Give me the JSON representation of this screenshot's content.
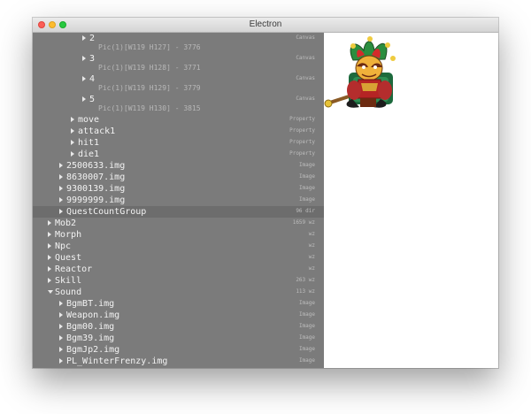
{
  "window": {
    "title": "Electron"
  },
  "tree": [
    {
      "label": "2",
      "type": "Canvas",
      "depth": 4,
      "arrow": "right",
      "sub": "Pic(1)[W119 H127] - 3776"
    },
    {
      "label": "3",
      "type": "Canvas",
      "depth": 4,
      "arrow": "right",
      "sub": "Pic(1)[W119 H128] - 3771"
    },
    {
      "label": "4",
      "type": "Canvas",
      "depth": 4,
      "arrow": "right",
      "sub": "Pic(1)[W119 H129] - 3779"
    },
    {
      "label": "5",
      "type": "Canvas",
      "depth": 4,
      "arrow": "right",
      "sub": "Pic(1)[W119 H130] - 3815"
    },
    {
      "label": "move",
      "type": "Property",
      "depth": 3,
      "arrow": "right"
    },
    {
      "label": "attack1",
      "type": "Property",
      "depth": 3,
      "arrow": "right"
    },
    {
      "label": "hit1",
      "type": "Property",
      "depth": 3,
      "arrow": "right"
    },
    {
      "label": "die1",
      "type": "Property",
      "depth": 3,
      "arrow": "right"
    },
    {
      "label": "2500633.img",
      "type": "Image",
      "depth": 2,
      "arrow": "right"
    },
    {
      "label": "8630007.img",
      "type": "Image",
      "depth": 2,
      "arrow": "right"
    },
    {
      "label": "9300139.img",
      "type": "Image",
      "depth": 2,
      "arrow": "right"
    },
    {
      "label": "9999999.img",
      "type": "Image",
      "depth": 2,
      "arrow": "right"
    },
    {
      "label": "QuestCountGroup",
      "type": "96 dir",
      "depth": 2,
      "arrow": "right",
      "selected": true
    },
    {
      "label": "Mob2",
      "type": "1659 wz",
      "depth": 1,
      "arrow": "right"
    },
    {
      "label": "Morph",
      "type": "wz",
      "depth": 1,
      "arrow": "right"
    },
    {
      "label": "Npc",
      "type": "wz",
      "depth": 1,
      "arrow": "right"
    },
    {
      "label": "Quest",
      "type": "wz",
      "depth": 1,
      "arrow": "right"
    },
    {
      "label": "Reactor",
      "type": "wz",
      "depth": 1,
      "arrow": "right"
    },
    {
      "label": "Skill",
      "type": "263 wz",
      "depth": 1,
      "arrow": "right"
    },
    {
      "label": "Sound",
      "type": "113 wz",
      "depth": 1,
      "arrow": "down"
    },
    {
      "label": "BgmBT.img",
      "type": "Image",
      "depth": 2,
      "arrow": "right"
    },
    {
      "label": "Weapon.img",
      "type": "Image",
      "depth": 2,
      "arrow": "right"
    },
    {
      "label": "Bgm00.img",
      "type": "Image",
      "depth": 2,
      "arrow": "right"
    },
    {
      "label": "Bgm39.img",
      "type": "Image",
      "depth": 2,
      "arrow": "right"
    },
    {
      "label": "BgmJp2.img",
      "type": "Image",
      "depth": 2,
      "arrow": "right"
    },
    {
      "label": "PL_WinterFrenzy.img",
      "type": "Image",
      "depth": 2,
      "arrow": "right"
    }
  ],
  "preview": {
    "sprite_icon": "jester-monster-sprite-icon"
  }
}
